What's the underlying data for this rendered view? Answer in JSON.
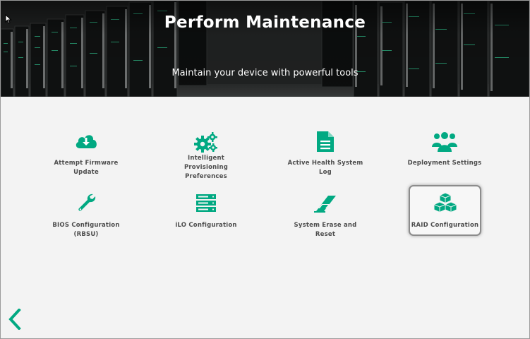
{
  "header": {
    "title": "Perform Maintenance",
    "subtitle": "Maintain your device with powerful tools"
  },
  "tiles": [
    {
      "label": "Attempt Firmware Update",
      "icon": "cloud-download-icon"
    },
    {
      "label": "Intelligent Provisioning Preferences",
      "icon": "gears-icon"
    },
    {
      "label": "Active Health System Log",
      "icon": "document-icon"
    },
    {
      "label": "Deployment Settings",
      "icon": "users-icon"
    },
    {
      "label": "BIOS Configuration (RBSU)",
      "icon": "wrench-icon"
    },
    {
      "label": "iLO Configuration",
      "icon": "server-stack-icon"
    },
    {
      "label": "System Erase and Reset",
      "icon": "eraser-icon"
    },
    {
      "label": "RAID Configuration",
      "icon": "cubes-icon",
      "selected": true
    }
  ],
  "colors": {
    "accent": "#01a982",
    "label": "#4d4d4d",
    "background": "#f3f3f3"
  },
  "nav": {
    "back_icon": "chevron-left-icon"
  }
}
